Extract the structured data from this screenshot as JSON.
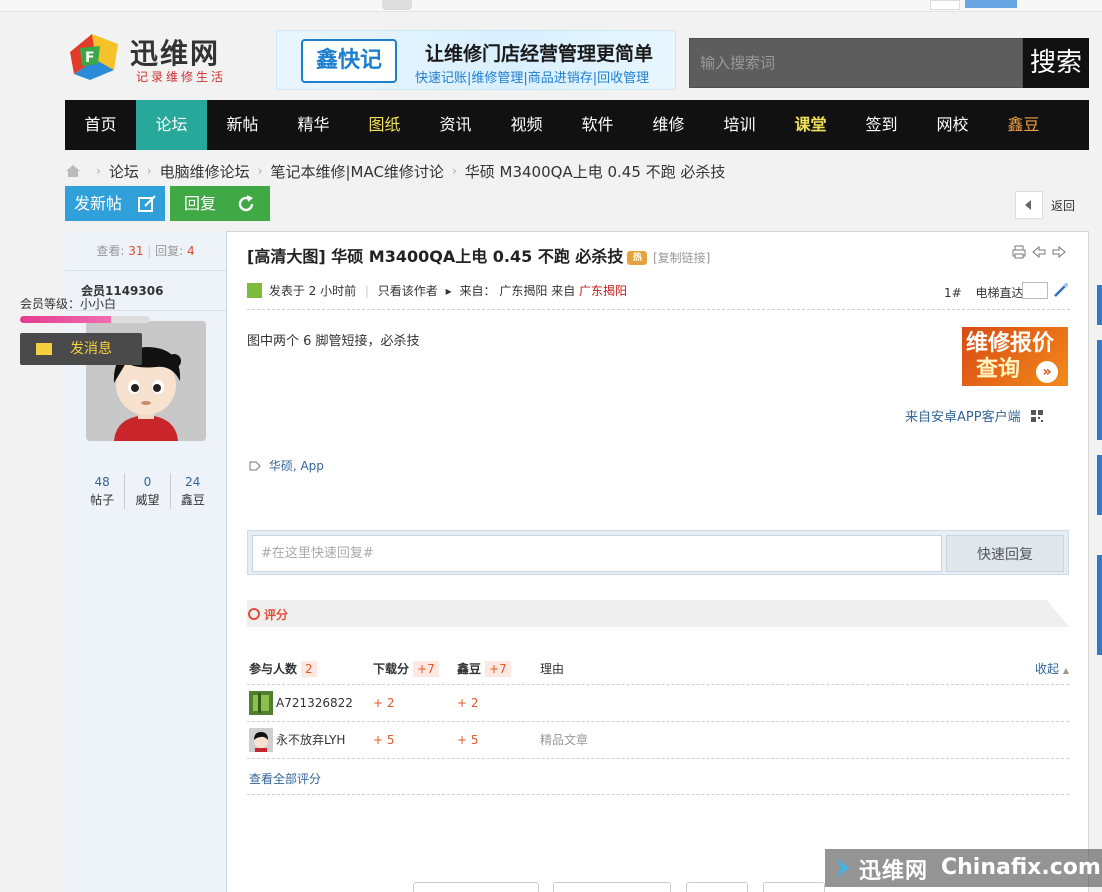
{
  "header": {
    "brand": "迅维网",
    "slogan": "记录维修生活",
    "banner_badge": "鑫快记",
    "banner_title": "让维修门店经营管理更简单",
    "banner_sub": "快速记账|维修管理|商品进销存|回收管理",
    "search_placeholder": "输入搜索词",
    "search_button": "搜索"
  },
  "nav": [
    "首页",
    "论坛",
    "新帖",
    "精华",
    "图纸",
    "资讯",
    "视频",
    "软件",
    "维修",
    "培训",
    "课堂",
    "签到",
    "网校",
    "鑫豆"
  ],
  "breadcrumb": [
    "论坛",
    "电脑维修论坛",
    "笔记本维修|MAC维修讨论",
    "华硕 M3400QA上电 0.45 不跑 必杀技"
  ],
  "actions": {
    "new_post": "发新帖",
    "reply": "回复",
    "back": "返回"
  },
  "sidebar": {
    "views_label": "查看:",
    "views": "31",
    "replies_label": "回复:",
    "replies": "4",
    "username": "会员1149306",
    "counts": [
      {
        "value": "48",
        "label": "帖子"
      },
      {
        "value": "0",
        "label": "威望"
      },
      {
        "value": "24",
        "label": "鑫豆"
      }
    ],
    "level": "会员等级：小小白",
    "level_progress": 0.7,
    "message_button": "发消息"
  },
  "post": {
    "title": "[高清大图] 华硕 M3400QA上电 0.45 不跑 必杀技",
    "copy_link": "[复制链接]",
    "posted": "发表于 2 小时前",
    "only_author": "只看该作者",
    "from_label": "来自：",
    "from_place": "广东揭阳",
    "from_label2": "来自",
    "from_place2": "广东揭阳",
    "floor": "1#",
    "elevator": "电梯直达",
    "content": "图中两个 6 脚管短接，必杀技",
    "from_app": "来自安卓APP客户端",
    "tags": "华硕, App",
    "ad_line1": "维修报价",
    "ad_line2": "查询"
  },
  "quick_reply": {
    "placeholder": "#在这里快速回复#",
    "button": "快速回复"
  },
  "rating": {
    "title": "评分",
    "headers": {
      "participants": "参与人数",
      "participants_count": "2",
      "download": "下载分",
      "download_total": "+7",
      "xindou": "鑫豆",
      "xindou_total": "+7",
      "reason": "理由",
      "collapse": "收起"
    },
    "rows": [
      {
        "user": "A721326822",
        "download": "+ 2",
        "xindou": "+ 2",
        "reason": ""
      },
      {
        "user": "永不放弃LYH",
        "download": "+ 5",
        "xindou": "+ 5",
        "reason": "精品文章"
      }
    ],
    "view_all": "查看全部评分"
  },
  "watermark": {
    "cn": "迅维网",
    "en": "Chinafix.com"
  },
  "colors": {
    "nav_active": "#27a89a",
    "new_post": "#2fa0d9",
    "reply": "#41a846",
    "accent_red": "#e34e3b"
  }
}
